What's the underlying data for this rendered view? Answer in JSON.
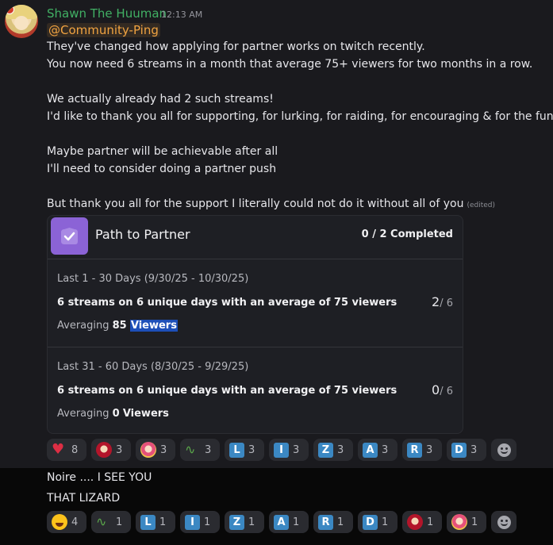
{
  "message1": {
    "username": "Shawn The Huuman",
    "timestamp": "12:13 AM",
    "mention": "@Community-Ping",
    "lines": [
      "They've changed how applying for partner works on twitch recently.",
      "You now need 6 streams in a month that average 75+ viewers for two months in a row.",
      "We actually already had 2 such streams!",
      "I'd like to thank you all for supporting, for lurking, for raiding, for encouraging & for the fun",
      "Maybe partner will be achievable after all",
      "I'll need to consider doing a partner push",
      "But thank you all for the support I literally could not do it without all of you"
    ],
    "edited": "(edited)"
  },
  "card": {
    "title": "Path to Partner",
    "completed": "0 / 2 Completed",
    "sections": [
      {
        "range": "Last 1 - 30 Days (9/30/25 - 10/30/25)",
        "goal": "6 streams on 6 unique days with an average of 75 viewers",
        "count": "2",
        "total": "/ 6",
        "avg_label": "Averaging",
        "avg_value": "85",
        "avg_unit": "Viewers"
      },
      {
        "range": "Last 31 - 60 Days (8/30/25 - 9/29/25)",
        "goal": "6 streams on 6 unique days with an average of 75 viewers",
        "count": "0",
        "total": "/ 6",
        "avg_label": "Averaging",
        "avg_value": "0",
        "avg_unit": "Viewers"
      }
    ]
  },
  "reactions1": [
    {
      "icon": "heart-icon",
      "count": "8"
    },
    {
      "icon": "anime-girl-red-emoji",
      "count": "3"
    },
    {
      "icon": "anime-girl-pink-emoji",
      "count": "3"
    },
    {
      "icon": "lizard-emoji",
      "count": "3"
    },
    {
      "icon": "letter-l",
      "letter": "L",
      "count": "3"
    },
    {
      "icon": "letter-i",
      "letter": "I",
      "count": "3"
    },
    {
      "icon": "letter-z",
      "letter": "Z",
      "count": "3"
    },
    {
      "icon": "letter-a",
      "letter": "A",
      "count": "3"
    },
    {
      "icon": "letter-r",
      "letter": "R",
      "count": "3"
    },
    {
      "icon": "letter-d",
      "letter": "D",
      "count": "3"
    }
  ],
  "message2": {
    "lines": [
      "Noire .... I SEE YOU",
      "THAT LIZARD"
    ]
  },
  "reactions2": [
    {
      "icon": "rofl-emoji",
      "count": "4"
    },
    {
      "icon": "lizard-emoji",
      "count": "1"
    },
    {
      "icon": "letter-l",
      "letter": "L",
      "count": "1"
    },
    {
      "icon": "letter-i",
      "letter": "I",
      "count": "1"
    },
    {
      "icon": "letter-z",
      "letter": "Z",
      "count": "1"
    },
    {
      "icon": "letter-a",
      "letter": "A",
      "count": "1"
    },
    {
      "icon": "letter-r",
      "letter": "R",
      "count": "1"
    },
    {
      "icon": "letter-d",
      "letter": "D",
      "count": "1"
    },
    {
      "icon": "anime-girl-red-emoji",
      "count": "1"
    },
    {
      "icon": "anime-girl-pink-emoji",
      "count": "1"
    }
  ],
  "colors": {
    "username": "#41b064",
    "mention": "#f0a341",
    "card_check_bg": "#8b63d6",
    "highlight": "#1d4fb8"
  }
}
